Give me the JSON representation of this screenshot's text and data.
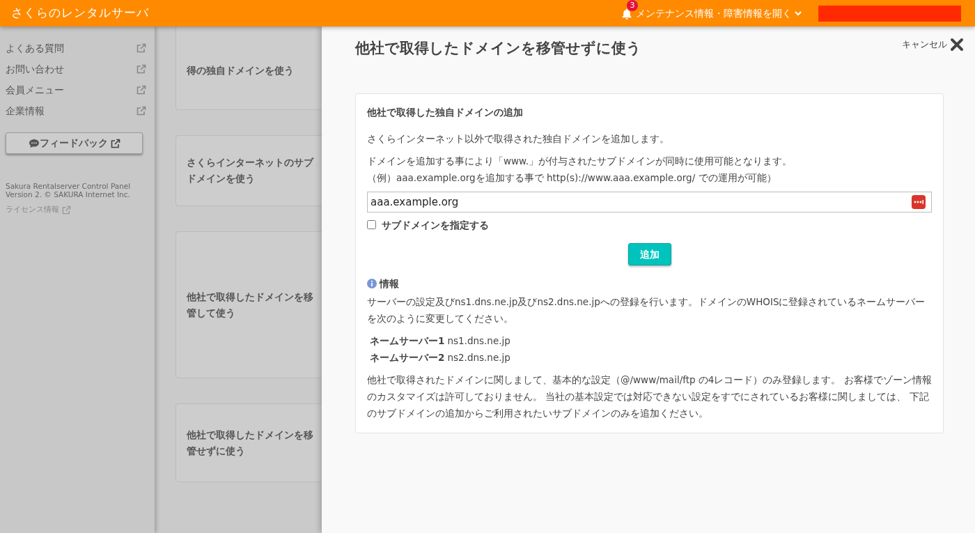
{
  "header": {
    "title": "さくらのレンタルサーバ",
    "notification_count": "3",
    "maintenance_link": "メンテナンス情報・障害情報を開く"
  },
  "sidebar": {
    "items": [
      {
        "label": "よくある質問"
      },
      {
        "label": "お問い合わせ"
      },
      {
        "label": "会員メニュー"
      },
      {
        "label": "企業情報"
      }
    ],
    "feedback_button": "フィードバック",
    "footer": "Sakura Rentalserver Control Panel Version 2. © SAKURA Internet Inc.",
    "license_link": "ライセンス情報"
  },
  "options": [
    {
      "label": "得の独自ドメインを使う"
    },
    {
      "label": "さくらインターネットのサブドメインを使う"
    },
    {
      "label": "他社で取得したドメインを移管して使う"
    },
    {
      "label": "他社で取得したドメインを移管せずに使う"
    }
  ],
  "panel": {
    "title": "他社で取得したドメインを移管せずに使う",
    "cancel": "キャンセル",
    "card": {
      "heading": "他社で取得した独自ドメインの追加",
      "description": "さくらインターネット以外で取得された独自ドメインを追加します。",
      "note_lines": [
        "ドメインを追加する事により「www.」が付与されたサブドメインが同時に使用可能となります。",
        "（例）aaa.example.orgを追加する事で http(s)://www.aaa.example.org/ での運用が可能）"
      ],
      "domain_field": {
        "value": "aaa.example.org"
      },
      "subdomain_checkbox": {
        "label": "サブドメインを指定する",
        "checked": false
      },
      "add_button": "追加",
      "info_heading": "情報",
      "info_text": "サーバーの設定及びns1.dns.ne.jp及びns2.dns.ne.jpへの登録を行います。ドメインのWHOISに登録されているネームサーバーを次のように変更してください。",
      "nameservers": [
        {
          "label": "ネームサーバー1",
          "value": "ns1.dns.ne.jp"
        },
        {
          "label": "ネームサーバー2",
          "value": "ns2.dns.ne.jp"
        }
      ],
      "footnote": "他社で取得されたドメインに関しまして、基本的な設定（@/www/mail/ftp の4レコード）のみ登録します。 お客様でゾーン情報のカスタマイズは許可しておりません。 当社の基本設定では対応できない設定をすでにされているお客様に関しましては、 下記のサブドメインの追加からご利用されたいサブドメインのみを追加ください。"
    }
  }
}
